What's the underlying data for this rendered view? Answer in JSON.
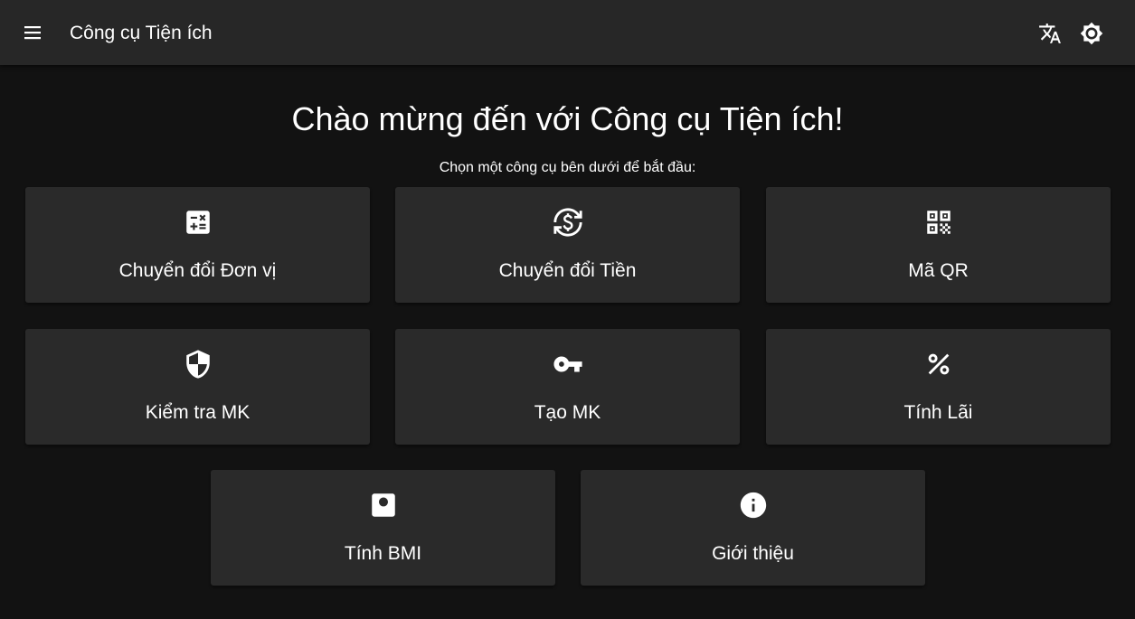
{
  "appbar": {
    "title": "Công cụ Tiện ích",
    "menu_icon": "menu-icon",
    "translate_icon": "translate-icon",
    "theme_icon": "brightness-icon"
  },
  "main": {
    "welcome": "Chào mừng đến với Công cụ Tiện ích!",
    "subtitle": "Chọn một công cụ bên dưới để bắt đầu:"
  },
  "tools": [
    {
      "label": "Chuyển đổi Đơn vị",
      "icon": "calculator-icon"
    },
    {
      "label": "Chuyển đổi Tiền",
      "icon": "currency-exchange-icon"
    },
    {
      "label": "Mã QR",
      "icon": "qr-code-icon"
    },
    {
      "label": "Kiểm tra MK",
      "icon": "security-shield-icon"
    },
    {
      "label": "Tạo MK",
      "icon": "key-icon"
    },
    {
      "label": "Tính Lãi",
      "icon": "percent-icon"
    },
    {
      "label": "Tính BMI",
      "icon": "scale-icon"
    },
    {
      "label": "Giới thiệu",
      "icon": "info-icon"
    }
  ],
  "colors": {
    "background": "#121212",
    "appbar": "#272727",
    "card": "#2a2a2a",
    "text": "#ffffff"
  }
}
